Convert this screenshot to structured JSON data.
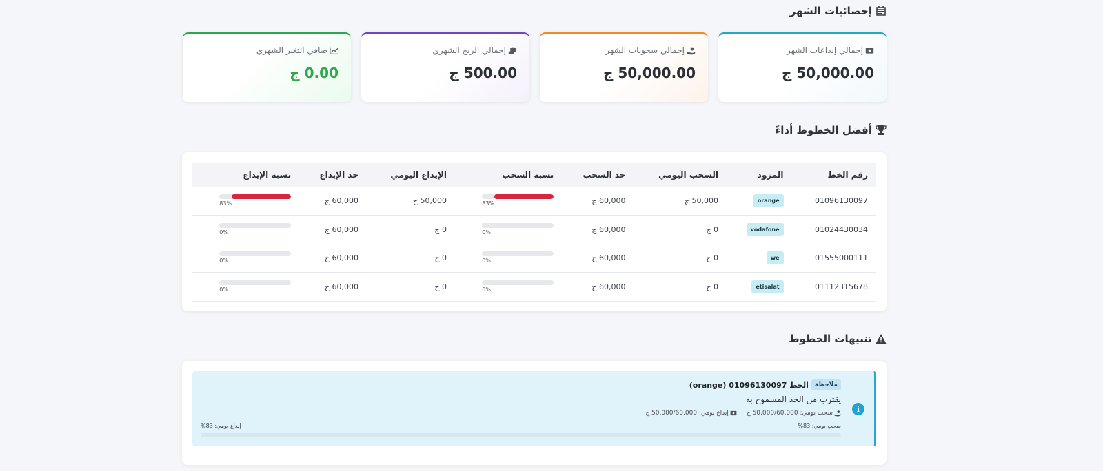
{
  "monthly_stats": {
    "title": "إحصائيات الشهر",
    "cards": [
      {
        "label": "إجمالي إيداعات الشهر",
        "value": "50,000.00 ج",
        "icon": "money-bill-icon",
        "accent": "#22a6c9"
      },
      {
        "label": "إجمالي سحوبات الشهر",
        "value": "50,000.00 ج",
        "icon": "hand-holding-usd-icon",
        "accent": "#f08a24"
      },
      {
        "label": "إجمالي الربح الشهري",
        "value": "500.00 ج",
        "icon": "coins-icon",
        "accent": "#7046c2"
      },
      {
        "label": "صافي التغير الشهري",
        "value": "0.00 ج",
        "icon": "chart-line-icon",
        "accent": "#2aa84a"
      }
    ]
  },
  "top_lines": {
    "title": "أفضل الخطوط أداءً",
    "columns": [
      "رقم الخط",
      "المزود",
      "السحب اليومي",
      "حد السحب",
      "نسبة السحب",
      "الإيداع اليومي",
      "حد الإيداع",
      "نسبة الإيداع"
    ],
    "rows": [
      {
        "number": "01096130097",
        "provider": "orange",
        "daily_withdraw": "50,000 ج",
        "withdraw_limit": "60,000 ج",
        "withdraw_pct": 83,
        "withdraw_pct_label": "83%",
        "daily_deposit": "50,000 ج",
        "deposit_limit": "60,000 ج",
        "deposit_pct": 83,
        "deposit_pct_label": "83%"
      },
      {
        "number": "01024430034",
        "provider": "vodafone",
        "daily_withdraw": "0 ج",
        "withdraw_limit": "60,000 ج",
        "withdraw_pct": 0,
        "withdraw_pct_label": "0%",
        "daily_deposit": "0 ج",
        "deposit_limit": "60,000 ج",
        "deposit_pct": 0,
        "deposit_pct_label": "0%"
      },
      {
        "number": "01555000111",
        "provider": "we",
        "daily_withdraw": "0 ج",
        "withdraw_limit": "60,000 ج",
        "withdraw_pct": 0,
        "withdraw_pct_label": "0%",
        "daily_deposit": "0 ج",
        "deposit_limit": "60,000 ج",
        "deposit_pct": 0,
        "deposit_pct_label": "0%"
      },
      {
        "number": "01112315678",
        "provider": "etisalat",
        "daily_withdraw": "0 ج",
        "withdraw_limit": "60,000 ج",
        "withdraw_pct": 0,
        "withdraw_pct_label": "0%",
        "daily_deposit": "0 ج",
        "deposit_limit": "60,000 ج",
        "deposit_pct": 0,
        "deposit_pct_label": "0%"
      }
    ],
    "bar_color": "#d7263d"
  },
  "line_alerts": {
    "title": "تنبيهات الخطوط",
    "alert": {
      "badge": "ملاحظة",
      "heading": "الخط 01096130097 (orange)",
      "message": "يقترب من الحد المسموح به",
      "withdraw_meta": "سحب يومي: 50,000/60,000 ج",
      "deposit_meta": "إيداع يومي: 50,000/60,000 ج",
      "withdraw_pct_label": "سحب يومي: 83%",
      "deposit_pct_label": "إيداع يومي: 83%"
    }
  }
}
